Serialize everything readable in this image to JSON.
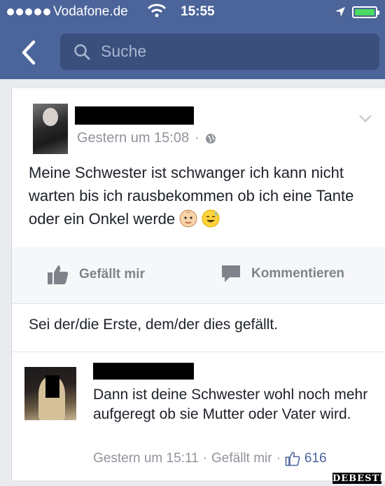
{
  "status_bar": {
    "carrier": "Vodafone.de",
    "time": "15:55",
    "battery_color": "#4cd964"
  },
  "nav": {
    "back_icon": "chevron-left-icon",
    "search_placeholder": "Suche",
    "bar_color": "#4b649a"
  },
  "post": {
    "timestamp": "Gestern um 15:08",
    "separator": "·",
    "privacy_icon": "globe-icon",
    "text": "Meine Schwester ist schwanger ich kann nicht warten bis ich rausbekommen ob ich eine Tante oder ein Onkel werde",
    "emojis": [
      "baby-face-icon",
      "grinning-sweat-icon"
    ]
  },
  "actions": {
    "like_label": "Gefällt mir",
    "comment_label": "Kommentieren"
  },
  "like_summary": "Sei der/die Erste, dem/der dies gefällt.",
  "comment": {
    "text": "Dann ist deine Schwester wohl noch mehr aufgeregt ob sie Mutter oder Vater wird.",
    "timestamp": "Gestern um 15:11",
    "like_label": "Gefällt mir",
    "like_count": "616"
  },
  "watermark": "DEBESTE"
}
